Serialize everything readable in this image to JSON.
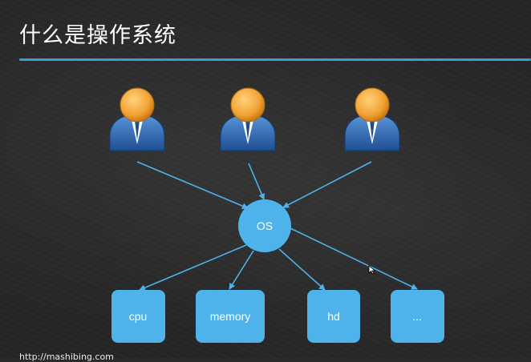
{
  "slide": {
    "title": "什么是操作系统",
    "footer_url": "http://mashibing.com"
  },
  "diagram": {
    "users": [
      {
        "icon": "user-icon"
      },
      {
        "icon": "user-icon"
      },
      {
        "icon": "user-icon"
      }
    ],
    "center": {
      "label": "OS"
    },
    "resources": [
      {
        "label": "cpu"
      },
      {
        "label": "memory"
      },
      {
        "label": "hd"
      },
      {
        "label": "..."
      }
    ]
  },
  "colors": {
    "accent": "#4db3ea",
    "rule": "#3a9ed6",
    "user_head": "#f2a234",
    "user_body": "#2d6bb5",
    "background": "#262626"
  }
}
